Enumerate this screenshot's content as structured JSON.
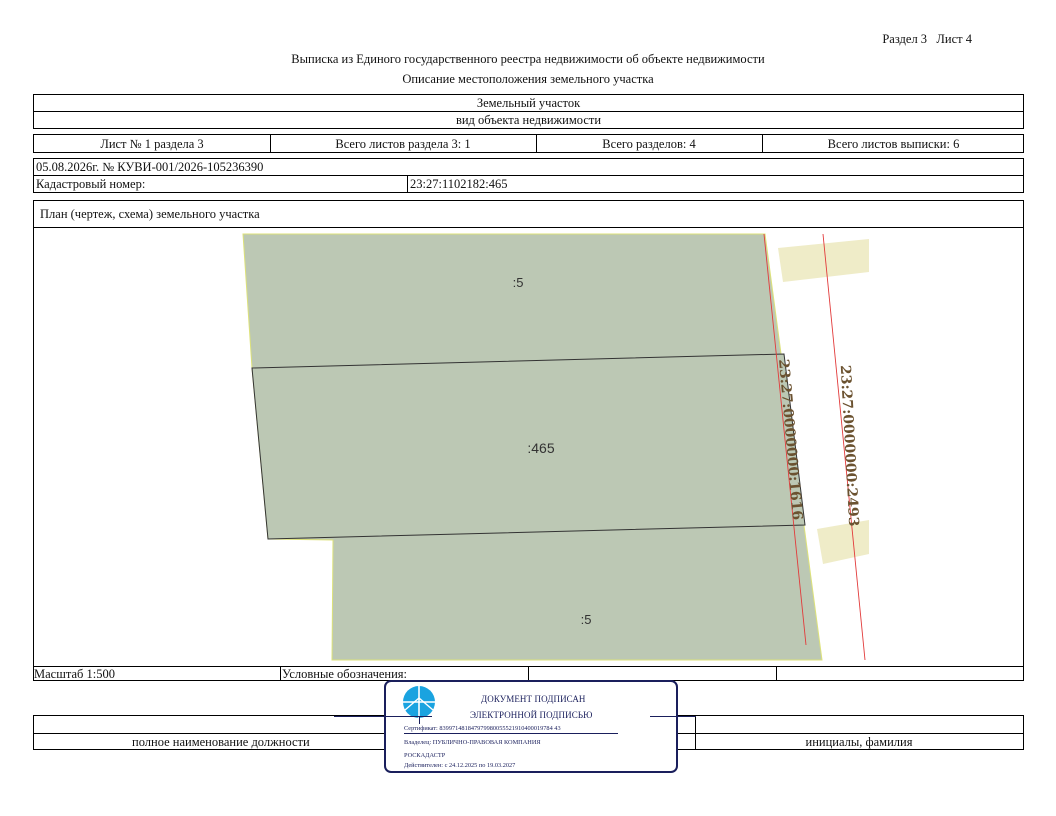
{
  "header": {
    "section_sheet": "Раздел 3   Лист 4",
    "title": "Выписка из Единого государственного реестра недвижимости об объекте недвижимости",
    "subtitle": "Описание местоположения земельного участка"
  },
  "object": {
    "type": "Земельный участок",
    "type_caption": "вид объекта недвижимости"
  },
  "sheets": {
    "sheet_of_section": "Лист № 1 раздела 3",
    "total_sheets_section": "Всего листов раздела 3: 1",
    "total_sections": "Всего разделов: 4",
    "total_sheets_extract": "Всего листов выписки: 6"
  },
  "record": {
    "date_number": "05.08.2026г. № КУВИ-001/2026-105236390",
    "cadastral_label": "Кадастровый номер:",
    "cadastral_value": "23:27:1102182:465"
  },
  "plan": {
    "title": "План (чертеж, схема) земельного участка",
    "labels": {
      "parcel_top": ":5",
      "parcel_main": ":465",
      "parcel_bottom": ":5",
      "quarter_1616": "23:27:0000000:1616",
      "quarter_2493": "23:27:0000000:2493"
    },
    "colors": {
      "parcel_fill": "#bcc8b4",
      "neighbor_fill": "#efecc8",
      "boundary_red": "#e23b3b",
      "label_brown": "#6b5230"
    }
  },
  "footer": {
    "scale": "Масштаб 1:500",
    "legend_label": "Условные обозначения:",
    "position_caption": "полное наименование должности",
    "name_caption": "инициалы, фамилия"
  },
  "stamp": {
    "line1": "ДОКУМЕНТ ПОДПИСАН",
    "line2": "ЭЛЕКТРОННОЙ ПОДПИСЬЮ",
    "certificate": "Сертификат: 839971481847979980055521910400019784 43",
    "owner": "Владелец: ПУБЛИЧНО-ПРАВОВАЯ КОМПАНИЯ",
    "owner2": "РОСКАДАСТР",
    "valid": "Действителен: с 24.12.2025 по 19.03.2027",
    "border_color": "#1a1f5c",
    "logo_color": "#1aa3e0"
  }
}
